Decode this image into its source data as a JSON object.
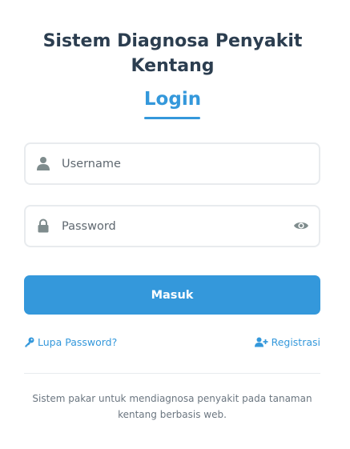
{
  "app": {
    "title_line1": "Sistem Diagnosa Penyakit",
    "title_line2": "Kentang"
  },
  "login": {
    "heading": "Login"
  },
  "form": {
    "username": {
      "placeholder": "Username",
      "value": "",
      "icon": "user-icon"
    },
    "password": {
      "placeholder": "Password",
      "value": "",
      "icon": "lock-icon",
      "toggle_icon": "eye-icon"
    },
    "submit_label": "Masuk"
  },
  "links": {
    "forgot_password": {
      "label": "Lupa Password?",
      "icon": "key-icon"
    },
    "register": {
      "label": "Registrasi",
      "icon": "user-plus-icon"
    }
  },
  "footer": {
    "line1": "Sistem pakar untuk mendiagnosa penyakit pada tanaman",
    "line2": "kentang berbasis web."
  },
  "colors": {
    "accent": "#3498db",
    "title": "#2c3e50",
    "icon": "#7f8c8d",
    "border": "#e8ebee"
  }
}
